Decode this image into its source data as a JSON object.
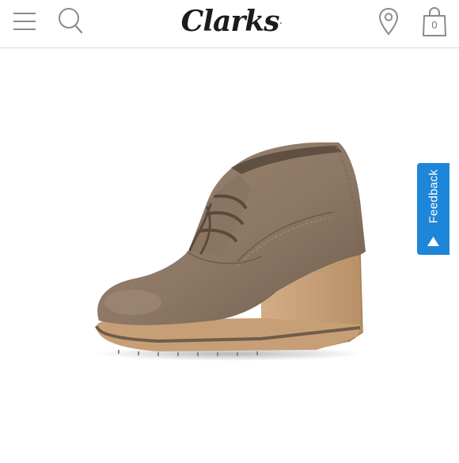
{
  "header": {
    "logo_text": "Clarks",
    "logo_mark": ".",
    "bag_count": "0"
  },
  "icons": {
    "menu": "hamburger-menu-icon",
    "search": "search-icon",
    "location": "location-pin-icon",
    "bag": "shopping-bag-icon"
  },
  "product": {
    "image": "tan-suede-wedge-ankle-boot"
  },
  "feedback": {
    "label": "Feedback"
  },
  "colors": {
    "feedback_bg": "#1e86d8",
    "icon_gray": "#8a8a8a",
    "logo": "#1c1c1c",
    "suede": "#8f7a66",
    "sole": "#c9a47d"
  }
}
